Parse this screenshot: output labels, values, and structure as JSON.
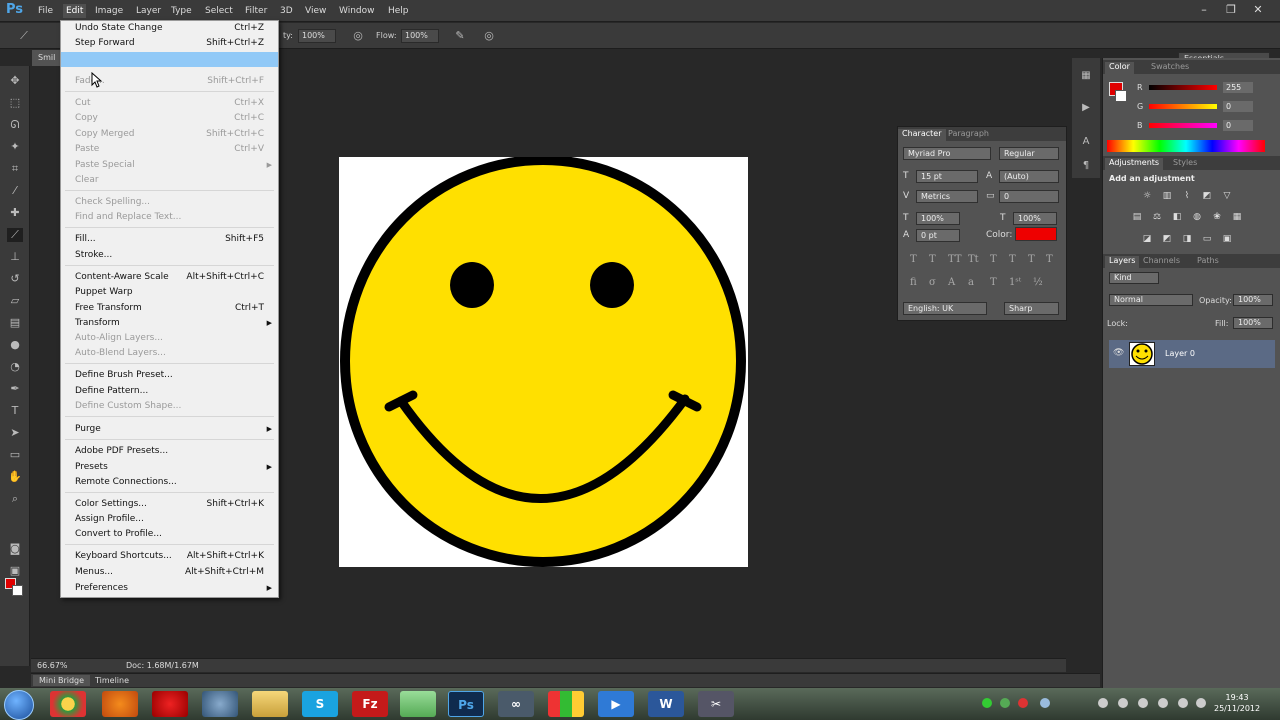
{
  "app": {
    "logo": "Ps"
  },
  "menubar": [
    "File",
    "Edit",
    "Image",
    "Layer",
    "Type",
    "Select",
    "Filter",
    "3D",
    "View",
    "Window",
    "Help"
  ],
  "window_controls": {
    "minimize": "–",
    "restore": "❐",
    "close": "✕"
  },
  "options": {
    "opacity_label": "ty:",
    "opacity_value": "100%",
    "flow_label": "Flow:",
    "flow_value": "100%",
    "workspace": "Essentials"
  },
  "document": {
    "tab": "Smil"
  },
  "edit_menu": {
    "items": [
      {
        "label": "Undo State Change",
        "shortcut": "Ctrl+Z",
        "disabled": false
      },
      {
        "label": "Step Forward",
        "shortcut": "Shift+Ctrl+Z",
        "disabled": false
      },
      {
        "label": "",
        "shortcut": "",
        "disabled": true,
        "highlighted": true
      },
      {
        "label": "Fade...",
        "shortcut": "Shift+Ctrl+F",
        "disabled": true
      },
      {
        "label": "Cut",
        "shortcut": "Ctrl+X",
        "disabled": true
      },
      {
        "label": "Copy",
        "shortcut": "Ctrl+C",
        "disabled": true
      },
      {
        "label": "Copy Merged",
        "shortcut": "Shift+Ctrl+C",
        "disabled": true
      },
      {
        "label": "Paste",
        "shortcut": "Ctrl+V",
        "disabled": true
      },
      {
        "label": "Paste Special",
        "shortcut": "",
        "disabled": true,
        "submenu": true
      },
      {
        "label": "Clear",
        "shortcut": "",
        "disabled": true
      },
      {
        "label": "Check Spelling...",
        "shortcut": "",
        "disabled": true
      },
      {
        "label": "Find and Replace Text...",
        "shortcut": "",
        "disabled": true
      },
      {
        "label": "Fill...",
        "shortcut": "Shift+F5",
        "disabled": false
      },
      {
        "label": "Stroke...",
        "shortcut": "",
        "disabled": false
      },
      {
        "label": "Content-Aware Scale",
        "shortcut": "Alt+Shift+Ctrl+C",
        "disabled": false
      },
      {
        "label": "Puppet Warp",
        "shortcut": "",
        "disabled": false
      },
      {
        "label": "Free Transform",
        "shortcut": "Ctrl+T",
        "disabled": false
      },
      {
        "label": "Transform",
        "shortcut": "",
        "disabled": false,
        "submenu": true
      },
      {
        "label": "Auto-Align Layers...",
        "shortcut": "",
        "disabled": true
      },
      {
        "label": "Auto-Blend Layers...",
        "shortcut": "",
        "disabled": true
      },
      {
        "label": "Define Brush Preset...",
        "shortcut": "",
        "disabled": false
      },
      {
        "label": "Define Pattern...",
        "shortcut": "",
        "disabled": false
      },
      {
        "label": "Define Custom Shape...",
        "shortcut": "",
        "disabled": true
      },
      {
        "label": "Purge",
        "shortcut": "",
        "disabled": false,
        "submenu": true
      },
      {
        "label": "Adobe PDF Presets...",
        "shortcut": "",
        "disabled": false
      },
      {
        "label": "Presets",
        "shortcut": "",
        "disabled": false,
        "submenu": true
      },
      {
        "label": "Remote Connections...",
        "shortcut": "",
        "disabled": false
      },
      {
        "label": "Color Settings...",
        "shortcut": "Shift+Ctrl+K",
        "disabled": false
      },
      {
        "label": "Assign Profile...",
        "shortcut": "",
        "disabled": false
      },
      {
        "label": "Convert to Profile...",
        "shortcut": "",
        "disabled": false
      },
      {
        "label": "Keyboard Shortcuts...",
        "shortcut": "Alt+Shift+Ctrl+K",
        "disabled": false
      },
      {
        "label": "Menus...",
        "shortcut": "Alt+Shift+Ctrl+M",
        "disabled": false
      },
      {
        "label": "Preferences",
        "shortcut": "",
        "disabled": false,
        "submenu": true
      }
    ]
  },
  "status": {
    "zoom": "66.67%",
    "doc": "Doc: 1.68M/1.67M"
  },
  "bottom_tabs": [
    "Mini Bridge",
    "Timeline"
  ],
  "color_panel": {
    "tabs": [
      "Color",
      "Swatches"
    ],
    "r_label": "R",
    "g_label": "G",
    "b_label": "B",
    "r": "255",
    "g": "0",
    "b": "0",
    "fg": "#e00000"
  },
  "adjustments": {
    "tabs": [
      "Adjustments",
      "Styles"
    ],
    "heading": "Add an adjustment"
  },
  "layers": {
    "tabs": [
      "Layers",
      "Channels",
      "Paths"
    ],
    "kind": "Kind",
    "blend": "Normal",
    "opacity_label": "Opacity:",
    "opacity": "100%",
    "lock_label": "Lock:",
    "fill_label": "Fill:",
    "fill": "100%",
    "layer_name": "Layer 0"
  },
  "character": {
    "tabs": [
      "Character",
      "Paragraph"
    ],
    "font": "Myriad Pro",
    "style": "Regular",
    "size": "15 pt",
    "leading": "(Auto)",
    "kerning": "Metrics",
    "tracking": "0",
    "vscale": "100%",
    "hscale": "100%",
    "baseline": "0 pt",
    "color_label": "Color:",
    "color": "#ee0000",
    "language": "English: UK",
    "aa": "Sharp"
  },
  "clock": {
    "time": "19:43",
    "date": "25/11/2012"
  }
}
